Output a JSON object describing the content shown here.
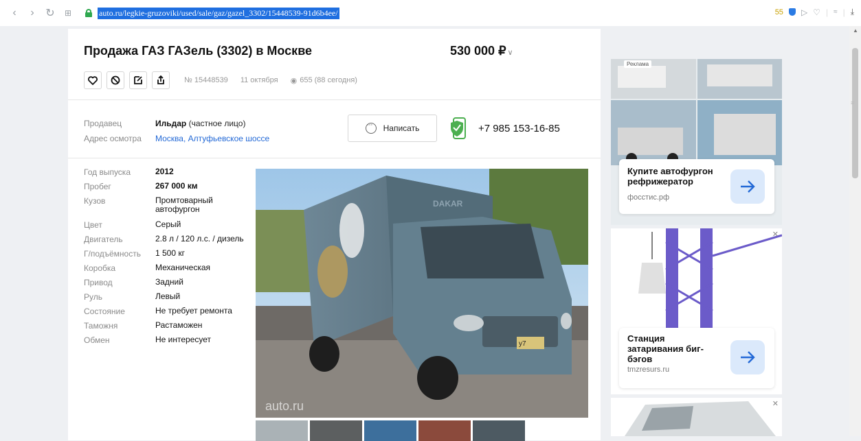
{
  "browser": {
    "url": "auto.ru/legkie-gruzoviki/used/sale/gaz/gazel_3302/15448539-91d6b4ee/",
    "counter": "55"
  },
  "listing": {
    "title": "Продажа ГАЗ ГАЗель (3302) в Москве",
    "price": "530 000 ₽",
    "number": "№ 15448539",
    "date": "11 октября",
    "views": "655 (88 сегодня)"
  },
  "seller": {
    "seller_label": "Продавец",
    "name": "Ильдар",
    "type": "(частное лицо)",
    "address_label": "Адрес осмотра",
    "address": "Москва, Алтуфьевское шоссе",
    "write_label": "Написать",
    "phone": "+7 985 153-16-85"
  },
  "specs": [
    {
      "k": "Год выпуска",
      "v": "2012"
    },
    {
      "k": "Пробег",
      "v": "267 000 км"
    },
    {
      "k": "Кузов",
      "v": "Промтоварный автофургон"
    },
    {
      "k": "Цвет",
      "v": "Серый"
    },
    {
      "k": "Двигатель",
      "v": "2.8 л / 120 л.с. / дизель"
    },
    {
      "k": "Г/подъёмность",
      "v": "1 500 кг"
    },
    {
      "k": "Коробка",
      "v": "Механическая"
    },
    {
      "k": "Привод",
      "v": "Задний"
    },
    {
      "k": "Руль",
      "v": "Левый"
    },
    {
      "k": "Состояние",
      "v": "Не требует ремонта"
    },
    {
      "k": "Таможня",
      "v": "Растаможен"
    },
    {
      "k": "Обмен",
      "v": "Не интересует"
    }
  ],
  "photo": {
    "watermark": "auto.ru",
    "plate": "у7"
  },
  "ads": {
    "tag": "Реклама",
    "ad1_title": "Купите автофургон рефрижератор",
    "ad1_domain": "фосстис.рф",
    "ad2_title": "Станция затаривания биг-бэгов",
    "ad2_domain": "tmzresurs.ru"
  },
  "colors": {
    "accent": "#2369d6",
    "url_highlight": "#1f6fe0",
    "phone_green": "#4caf50"
  }
}
